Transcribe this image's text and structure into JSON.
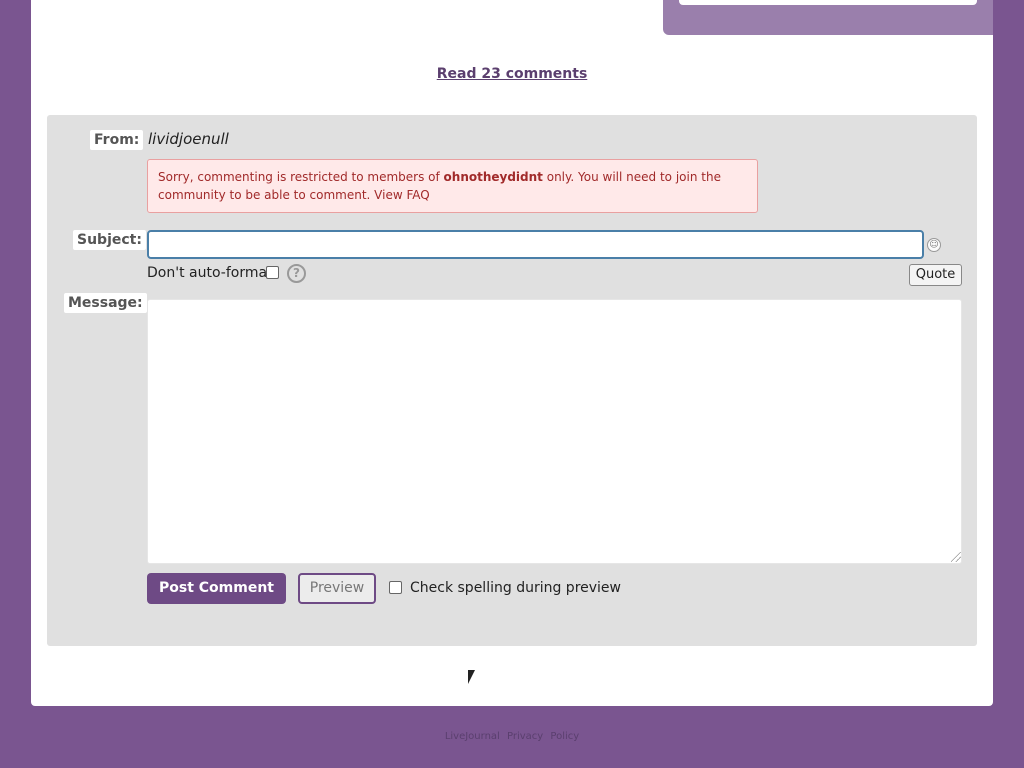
{
  "top": {
    "read_comments": "Read 23 comments"
  },
  "form": {
    "from_label": "From:",
    "from_value": "lividjoenull",
    "warning": {
      "part1": "Sorry, commenting is restricted to members of ",
      "community": "ohnotheydidnt",
      "part2": " only. You will need to join the community to be able to comment. ",
      "faq_link": "View FAQ"
    },
    "subject_label": "Subject:",
    "subject_value": "",
    "autoformat_label": "Don't auto-format:",
    "help_glyph": "?",
    "quote_label": "Quote",
    "message_label": "Message:",
    "message_value": "",
    "post_label": "Post Comment",
    "preview_label": "Preview",
    "spellcheck_label": "Check spelling during preview"
  },
  "footer": {
    "links": [
      "LiveJournal",
      "Privacy",
      "Policy"
    ]
  },
  "colors": {
    "page_bg": "#7a5590",
    "accent": "#6e4a85",
    "form_bg": "#e0e0e0",
    "warning_bg": "#ffe9e9",
    "warning_text": "#a12a2a"
  }
}
